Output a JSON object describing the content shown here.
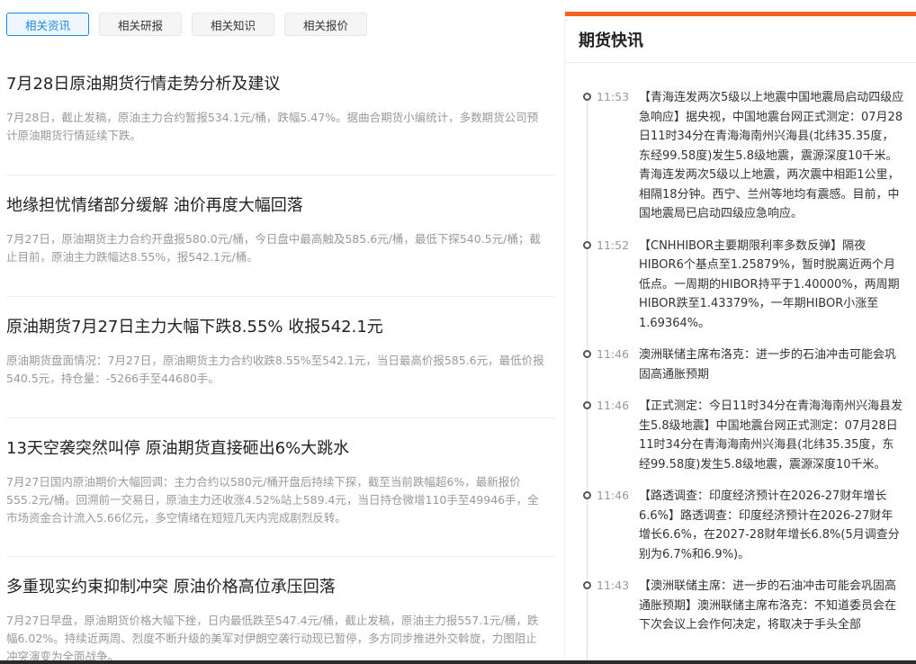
{
  "tabs": [
    {
      "label": "相关资讯",
      "active": true
    },
    {
      "label": "相关研报",
      "active": false
    },
    {
      "label": "相关知识",
      "active": false
    },
    {
      "label": "相关报价",
      "active": false
    }
  ],
  "news": [
    {
      "title": "7月28日原油期货行情走势分析及建议",
      "summary": "7月28日，截止发稿，原油主力合约暂报534.1元/桶，跌幅5.47%。据曲合期货小编统计，多数期货公司预计原油期货行情延续下跌。"
    },
    {
      "title": "地缘担忧情绪部分缓解 油价再度大幅回落",
      "summary": "7月27日，原油期货主力合约开盘报580.0元/桶，今日盘中最高触及585.6元/桶，最低下探540.5元/桶；截止目前，原油主力跌幅达8.55%，报542.1元/桶。"
    },
    {
      "title": "原油期货7月27日主力大幅下跌8.55% 收报542.1元",
      "summary": "原油期货盘面情况：7月27日，原油期货主力合约收跌8.55%至542.1元，当日最高价报585.6元，最低价报540.5元，持仓量：-5266手至44680手。"
    },
    {
      "title": "13天空袭突然叫停 原油期货直接砸出6%大跳水",
      "summary": "7月27日国内原油期价大幅回调：主力合约以580元/桶开盘后持续下探，截至当前跌幅超6%，最新报价555.2元/桶。回溯前一交易日，原油主力还收涨4.52%站上589.4元，当日持仓微增110手至49946手，全市场资金合计流入5.66亿元，多空情绪在短短几天内完成剧烈反转。"
    },
    {
      "title": "多重现实约束抑制冲突 原油价格高位承压回落",
      "summary": "7月27日早盘，原油期货价格大幅下挫，日内最低跌至547.4元/桶，截止发稿，原油主力报557.1元/桶，跌幅6.02%。持续近两周、烈度不断升级的美军对伊朗空袭行动现已暂停，多方同步推进外交斡旋，力图阻止冲突演变为全面战争。"
    }
  ],
  "flash": {
    "heading": "期货快讯",
    "accent_color": "#f4621e",
    "items": [
      {
        "time": "11:53",
        "text": "【青海连发两次5级以上地震中国地震局启动四级应急响应】据央视，中国地震台网正式测定：07月28日11时34分在青海海南州兴海县(北纬35.35度，东经99.58度)发生5.8级地震，震源深度10千米。青海连发两次5级以上地震，两次震中相距1公里，相隔18分钟。西宁、兰州等地均有震感。目前，中国地震局已启动四级应急响应。"
      },
      {
        "time": "11:52",
        "text": "【CNHHIBOR主要期限利率多数反弹】隔夜HIBOR6个基点至1.25879%，暂时脱离近两个月低点。一周期的HIBOR持平于1.40000%，两周期HIBOR跌至1.43379%，一年期HIBOR小涨至1.69364%。"
      },
      {
        "time": "11:46",
        "text": "澳洲联储主席布洛克：进一步的石油冲击可能会巩固高通胀预期"
      },
      {
        "time": "11:46",
        "text": "【正式测定：今日11时34分在青海海南州兴海县发生5.8级地震】中国地震台网正式测定：07月28日11时34分在青海海南州兴海县(北纬35.35度，东经99.58度)发生5.8级地震，震源深度10千米。"
      },
      {
        "time": "11:46",
        "text": "【路透调查：印度经济预计在2026-27财年增长6.6%】路透调查：印度经济预计在2026-27财年增长6.6%，在2027-28财年增长6.8%(5月调查分别为6.7%和6.9%)。"
      },
      {
        "time": "11:43",
        "text": "【澳洲联储主席：进一步的石油冲击可能会巩固高通胀预期】澳洲联储主席布洛克：不知道委员会在下次会议上会作何决定，将取决于手头全部"
      }
    ]
  }
}
